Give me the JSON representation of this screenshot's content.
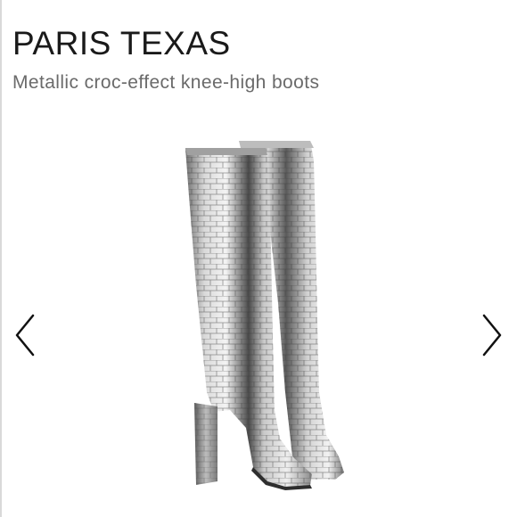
{
  "product": {
    "brand": "PARIS TEXAS",
    "subtitle": "Metallic croc-effect knee-high boots"
  },
  "image": {
    "subject": "boots-icon",
    "colors": {
      "metal_light": "#e6e6e6",
      "metal_mid": "#a9a9a9",
      "metal_dark": "#4a4a4a"
    }
  },
  "carousel": {
    "prev_icon": "chevron-left-icon",
    "next_icon": "chevron-right-icon",
    "icon_color": "#111111"
  }
}
